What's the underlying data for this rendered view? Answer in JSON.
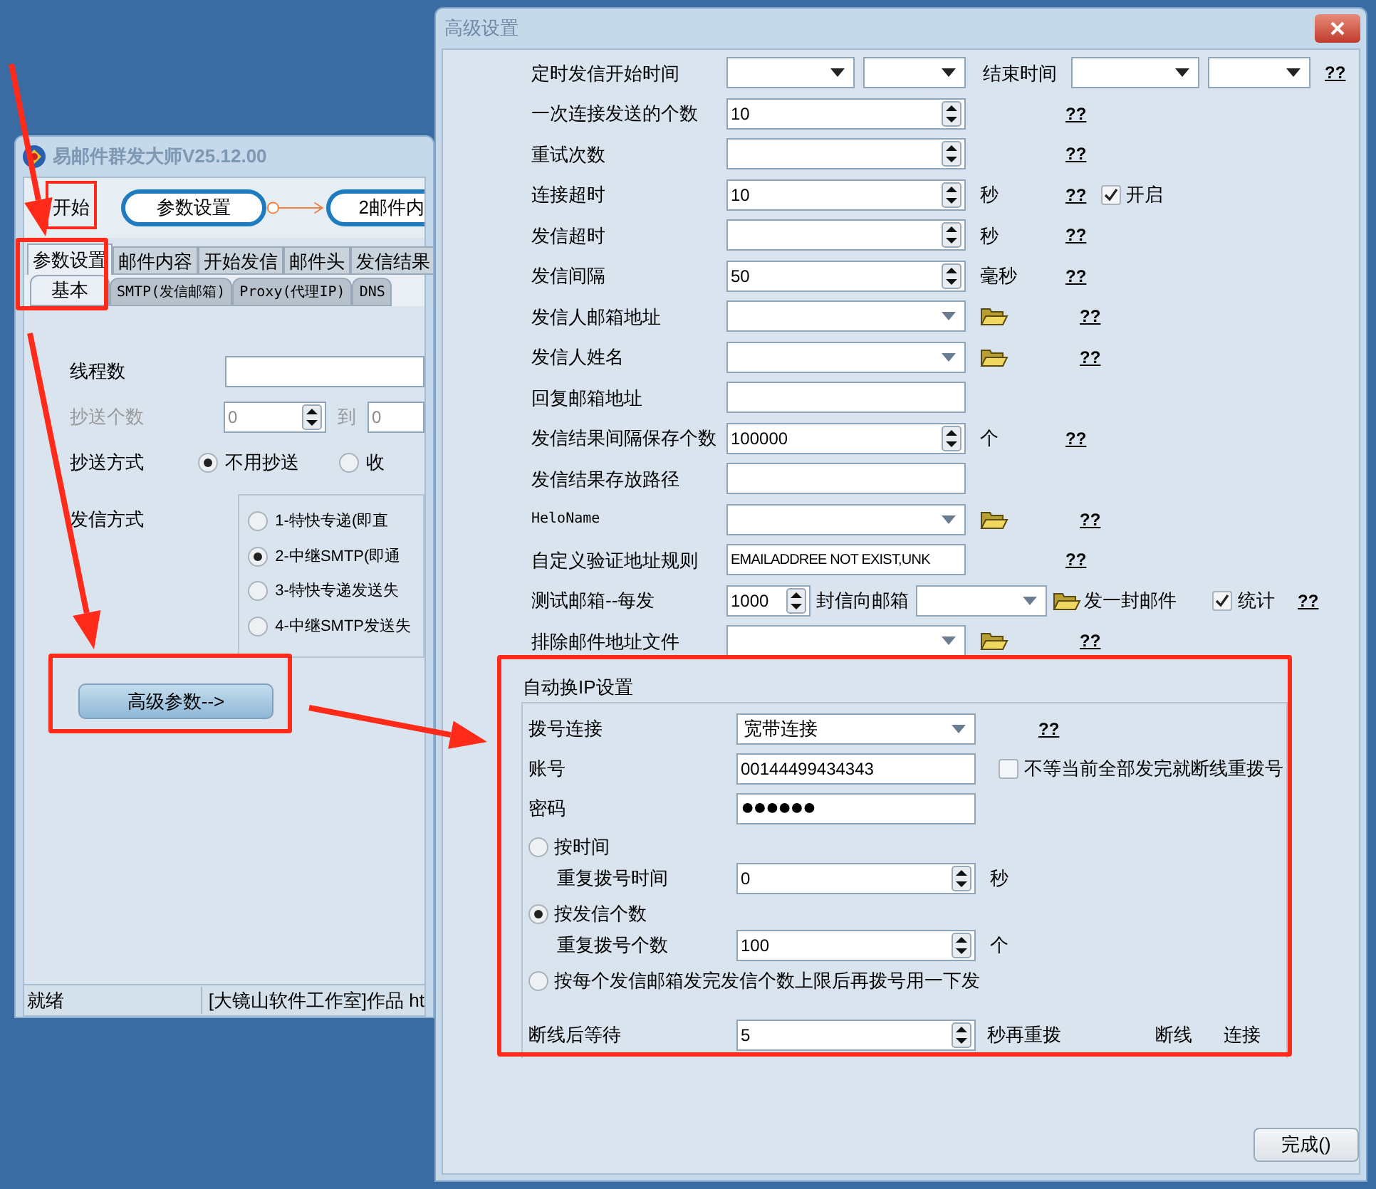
{
  "main_window": {
    "title": "易邮件群发大师V25.12.00",
    "start_button": "开始",
    "flow_steps": [
      "参数设置",
      "2邮件内"
    ],
    "tabs": [
      {
        "label": "参数设置",
        "selected": true
      },
      {
        "label": "邮件内容",
        "selected": false
      },
      {
        "label": "开始发信",
        "selected": false
      },
      {
        "label": "邮件头",
        "selected": false
      },
      {
        "label": "发信结果",
        "selected": false
      }
    ],
    "sub_tabs": [
      {
        "label": "基本",
        "selected": true
      },
      {
        "label": "SMTP(发信邮箱)",
        "selected": false
      },
      {
        "label": "Proxy(代理IP)",
        "selected": false
      },
      {
        "label": "DNS",
        "selected": false
      }
    ],
    "thread_count": {
      "label": "线程数"
    },
    "cc_count": {
      "label": "抄送个数",
      "disabled": true,
      "from": "0",
      "to_label": "到",
      "to": "0"
    },
    "cc_mode": {
      "label": "抄送方式",
      "options": [
        {
          "label": "不用抄送",
          "selected": true
        },
        {
          "label": "收",
          "selected": false
        }
      ]
    },
    "send_mode": {
      "label": "发信方式",
      "options": [
        {
          "label": "1-特快专递(即直",
          "selected": false
        },
        {
          "label": "2-中继SMTP(即通",
          "selected": true
        },
        {
          "label": "3-特快专递发送失",
          "selected": false
        },
        {
          "label": "4-中继SMTP发送失",
          "selected": false
        }
      ]
    },
    "advanced_button": "高级参数-->",
    "status_bar": [
      "就绪",
      "[大镜山软件工作室]作品 ht"
    ]
  },
  "dialog": {
    "title": "高级设置",
    "rows": [
      {
        "kind": "time-range",
        "label": "定时发信开始时间",
        "end_label": "结束时间",
        "help": "??"
      },
      {
        "kind": "spin",
        "label": "一次连接发送的个数",
        "value": "10",
        "help": "??"
      },
      {
        "kind": "spin",
        "label": "重试次数",
        "help": "??"
      },
      {
        "kind": "spin",
        "label": "连接超时",
        "value": "10",
        "unit": "秒",
        "help": "??",
        "checkbox": {
          "label": "开启",
          "checked": true
        }
      },
      {
        "kind": "spin",
        "label": "发信超时",
        "unit": "秒",
        "help": "??"
      },
      {
        "kind": "spin",
        "label": "发信间隔",
        "value": "50",
        "unit": "毫秒",
        "help": "??"
      },
      {
        "kind": "combo-browse",
        "label": "发信人邮箱地址",
        "help": "??"
      },
      {
        "kind": "combo-browse",
        "label": "发信人姓名",
        "help": "??"
      },
      {
        "kind": "text",
        "label": "回复邮箱地址"
      },
      {
        "kind": "spin",
        "label": "发信结果间隔保存个数",
        "value": "100000",
        "unit": "个",
        "help": "??"
      },
      {
        "kind": "text",
        "label": "发信结果存放路径"
      },
      {
        "kind": "combo-browse",
        "label": "HeloName",
        "help": "??"
      },
      {
        "kind": "text",
        "label": "自定义验证地址规则",
        "value": "EMAILADDREE NOT EXIST,UNK",
        "help": "??"
      },
      {
        "kind": "test-mail",
        "label": "测试邮箱--每发",
        "value": "1000",
        "middle": "封信向邮箱",
        "action": "发一封邮件",
        "checkbox": {
          "label": "统计",
          "checked": true
        },
        "help": "??"
      },
      {
        "kind": "combo-browse",
        "label": "排除邮件地址文件",
        "help": "??"
      }
    ],
    "auto_ip": {
      "title": "自动换IP设置",
      "rows": [
        {
          "kind": "combo",
          "label": "拨号连接",
          "value": "宽带连接",
          "help": "??"
        },
        {
          "kind": "text",
          "label": "账号",
          "value": "00144499434343",
          "checkbox": {
            "label": "不等当前全部发完就断线重拨号",
            "checked": false
          }
        },
        {
          "kind": "password",
          "label": "密码",
          "value": "●●●●●●"
        },
        {
          "kind": "radio",
          "label": "按时间",
          "selected": false
        },
        {
          "kind": "sub-spin",
          "label": "重复拨号时间",
          "value": "0",
          "unit": "秒"
        },
        {
          "kind": "radio",
          "label": "按发信个数",
          "selected": true
        },
        {
          "kind": "sub-spin",
          "label": "重复拨号个数",
          "value": "100",
          "unit": "个"
        },
        {
          "kind": "radio",
          "label": "按每个发信邮箱发完发信个数上限后再拨号用一下发",
          "selected": false
        },
        {
          "kind": "spin",
          "label": "断线后等待",
          "value": "5",
          "unit": "秒再重拨",
          "buttons": [
            "断线",
            "连接"
          ]
        }
      ]
    },
    "done_button": "完成()"
  }
}
